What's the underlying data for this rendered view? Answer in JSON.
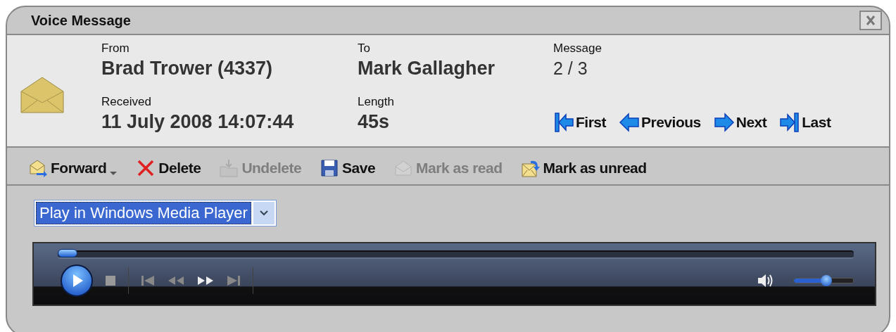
{
  "window": {
    "title": "Voice Message"
  },
  "header": {
    "fields": [
      {
        "label": "From",
        "value": "Brad Trower (4337)"
      },
      {
        "label": "To",
        "value": "Mark Gallagher"
      },
      {
        "label": "Message",
        "value": "2 / 3"
      },
      {
        "label": "Received",
        "value": "11 July 2008 14:07:44"
      },
      {
        "label": "Length",
        "value": "45s"
      }
    ],
    "navigation": [
      {
        "kind": "first",
        "label": "First"
      },
      {
        "kind": "previous",
        "label": "Previous"
      },
      {
        "kind": "next",
        "label": "Next"
      },
      {
        "kind": "last",
        "label": "Last"
      }
    ]
  },
  "toolbar": [
    {
      "kind": "forward",
      "label": "Forward",
      "disabled": false,
      "has_menu": true
    },
    {
      "kind": "delete",
      "label": "Delete",
      "disabled": false,
      "has_menu": false
    },
    {
      "kind": "undelete",
      "label": "Undelete",
      "disabled": true,
      "has_menu": false
    },
    {
      "kind": "save",
      "label": "Save",
      "disabled": false,
      "has_menu": false
    },
    {
      "kind": "read",
      "label": "Mark as read",
      "disabled": true,
      "has_menu": false
    },
    {
      "kind": "unread",
      "label": "Mark as unread",
      "disabled": false,
      "has_menu": false
    }
  ],
  "player_select": {
    "value": "Play in Windows Media Player"
  },
  "player": {
    "seek": {
      "level": 0
    },
    "volume": {
      "level": 0.55
    }
  }
}
